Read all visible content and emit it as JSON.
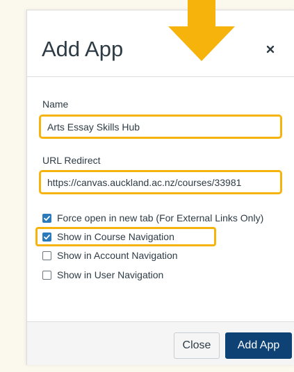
{
  "dialog": {
    "title": "Add App",
    "close_icon": "close-icon"
  },
  "form": {
    "name_label": "Name",
    "name_value": "Arts Essay Skills Hub",
    "url_label": "URL Redirect",
    "url_value": "https://canvas.auckland.ac.nz/courses/33981"
  },
  "options": [
    {
      "label": "Force open in new tab (For External Links Only)",
      "checked": true
    },
    {
      "label": "Show in Course Navigation",
      "checked": true
    },
    {
      "label": "Show in Account Navigation",
      "checked": false
    },
    {
      "label": "Show in User Navigation",
      "checked": false
    }
  ],
  "footer": {
    "close_label": "Close",
    "add_label": "Add App"
  },
  "colors": {
    "highlight": "#f5b30b",
    "primary_button": "#0e4275",
    "checkbox_checked": "#2b7abc"
  }
}
